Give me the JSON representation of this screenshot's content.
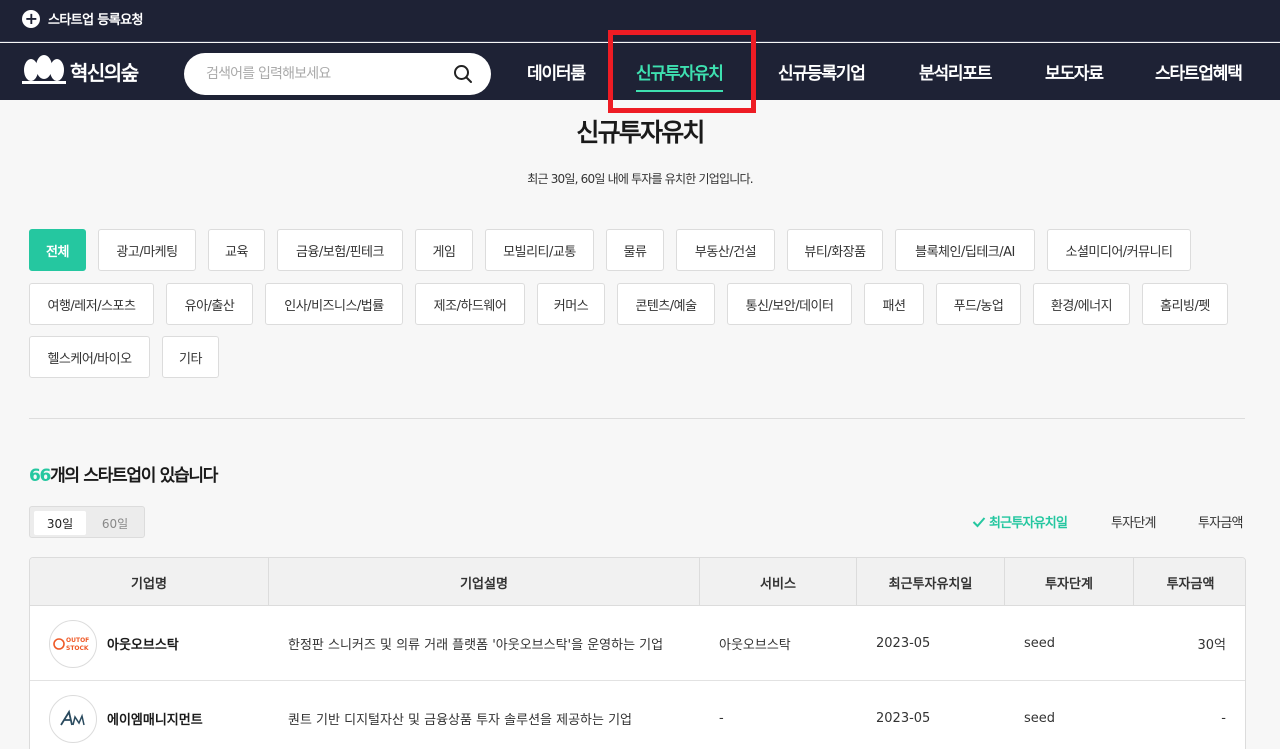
{
  "topbar": {
    "register_label": "스타트업 등록요청"
  },
  "logo": {
    "text": "혁신의숲"
  },
  "search": {
    "placeholder": "검색어를 입력해보세요"
  },
  "nav": [
    {
      "label": "데이터룸"
    },
    {
      "label": "신규투자유치",
      "active": true
    },
    {
      "label": "신규등록기업"
    },
    {
      "label": "분석리포트"
    },
    {
      "label": "보도자료"
    },
    {
      "label": "스타트업혜택"
    }
  ],
  "page": {
    "title": "신규투자유치",
    "subtitle": "최근 30일, 60일 내에 투자를 유치한 기업입니다."
  },
  "categories": [
    "전체",
    "광고/마케팅",
    "교육",
    "금융/보험/핀테크",
    "게임",
    "모빌리티/교통",
    "물류",
    "부동산/건설",
    "뷰티/화장품",
    "블록체인/딥테크/AI",
    "소셜미디어/커뮤니티",
    "여행/레저/스포츠",
    "유아/출산",
    "인사/비즈니스/법률",
    "제조/하드웨어",
    "커머스",
    "콘텐츠/예술",
    "통신/보안/데이터",
    "패션",
    "푸드/농업",
    "환경/에너지",
    "홈리빙/펫",
    "헬스케어/바이오",
    "기타"
  ],
  "results": {
    "count": "66",
    "suffix": "개의 스타트업이 있습니다"
  },
  "period": {
    "opt1": "30일",
    "opt2": "60일"
  },
  "sort": {
    "recent": "최근투자유치일",
    "stage": "투자단계",
    "amount": "투자금액"
  },
  "table": {
    "headers": [
      "기업명",
      "기업설명",
      "서비스",
      "최근투자유치일",
      "투자단계",
      "투자금액"
    ],
    "rows": [
      {
        "name": "아웃오브스탁",
        "desc": "한정판 스니커즈 및 의류 거래 플랫폼 '아웃오브스탁'을 운영하는 기업",
        "service": "아웃오브스탁",
        "date": "2023-05",
        "stage": "seed",
        "amount": "30억",
        "logo_text_1": "OUTOF",
        "logo_text_2": "STOCK"
      },
      {
        "name": "에이엠매니지먼트",
        "desc": "퀀트 기반 디지털자산 및 금융상품 투자 솔루션을 제공하는 기업",
        "service": "-",
        "date": "2023-05",
        "stage": "seed",
        "amount": "-"
      }
    ]
  },
  "colors": {
    "accent": "#25c7a0",
    "nav_bg": "#1e2235",
    "highlight": "#ee1c24"
  }
}
